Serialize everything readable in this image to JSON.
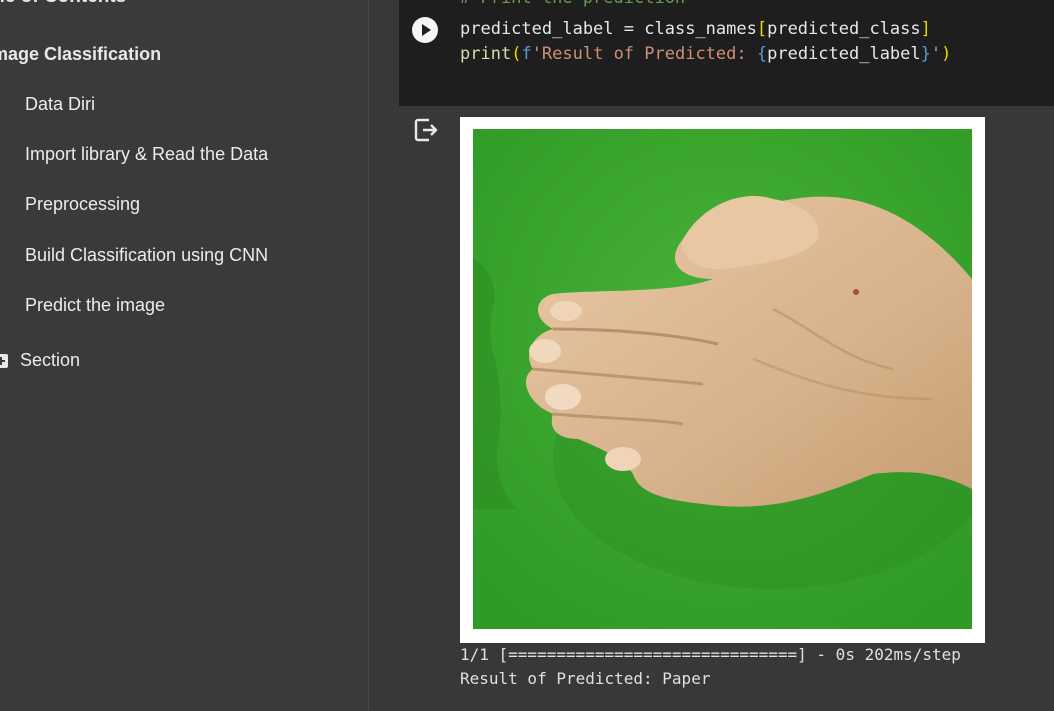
{
  "sidebar": {
    "title": "ble of Contents",
    "heading": "mage Classification",
    "items": [
      {
        "label": "Data Diri"
      },
      {
        "label": "Import library & Read the Data"
      },
      {
        "label": "Preprocessing"
      },
      {
        "label": "Build Classification using CNN"
      },
      {
        "label": "Predict the image"
      }
    ],
    "section_label": "Section"
  },
  "code_cell": {
    "comment": "# Print the prediction",
    "line1": {
      "var": "predicted_label",
      "op": " = ",
      "obj": "class_names",
      "open": "[",
      "index": "predicted_class",
      "close": "]"
    },
    "line2": {
      "fn": "print",
      "open_paren": "(",
      "prefix": "f",
      "str_start": "'Result of Predicted: ",
      "brace_open": "{",
      "expr": "predicted_label",
      "brace_close": "}",
      "str_end": "'",
      "close_paren": ")"
    }
  },
  "output": {
    "progress_line": "1/1 [==============================] - 0s 202ms/step",
    "result_line": "Result of Predicted: Paper"
  },
  "colors": {
    "background": "#383838",
    "code_bg": "#1e1e1e",
    "green_screen": "#3da42e",
    "skin": "#d9b690"
  },
  "icons": {
    "run": "play-circle-icon",
    "output": "output-exit-icon",
    "section_add": "plus-square-icon"
  }
}
